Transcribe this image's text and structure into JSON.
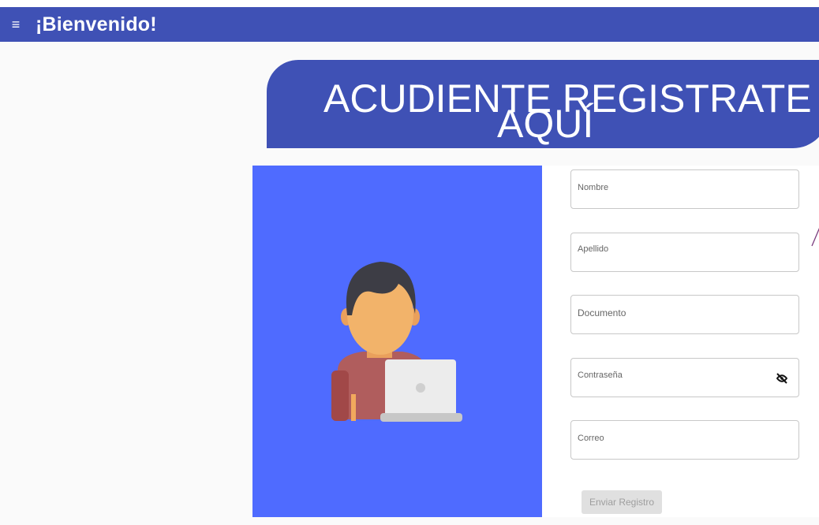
{
  "appbar": {
    "menu_icon": "menu-icon",
    "title": "¡Bienvenido!"
  },
  "banner": {
    "line1": "ACUDIENTE REGISTRATE",
    "line2": "AQUÍ"
  },
  "form": {
    "fields": [
      {
        "label": "Nombre"
      },
      {
        "label": "Apellido"
      },
      {
        "label": "Documento"
      },
      {
        "label": "Contraseña",
        "icon": "eye-slash-icon"
      },
      {
        "label": "Correo"
      }
    ],
    "submit_label": "Enviar Registro"
  },
  "colors": {
    "primary": "#3f51b5",
    "illustration_bg": "#4f6bff"
  }
}
